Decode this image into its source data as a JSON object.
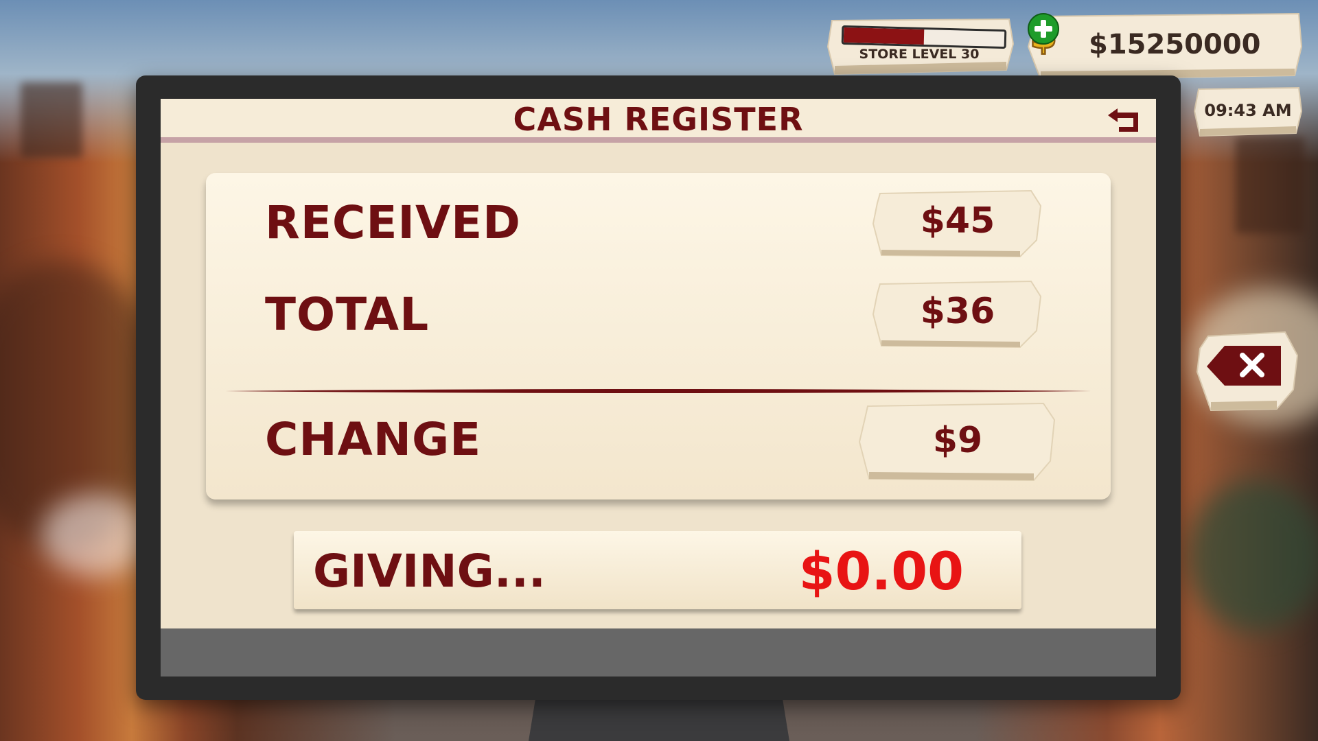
{
  "hud": {
    "store_level_label": "STORE LEVEL  30",
    "store_level_progress": 0.5,
    "money": "$15250000",
    "time": "09:43 AM"
  },
  "register": {
    "title": "CASH REGISTER",
    "rows": {
      "received": {
        "label": "RECEIVED",
        "value": "$45"
      },
      "total": {
        "label": "TOTAL",
        "value": "$36"
      },
      "change": {
        "label": "CHANGE",
        "value": "$9"
      }
    },
    "giving": {
      "label": "GIVING...",
      "amount": "$0.00"
    }
  },
  "icons": {
    "back": "back-arrow-icon",
    "coin": "dollar-coin-icon",
    "add": "plus-icon",
    "clear": "backspace-icon"
  },
  "colors": {
    "title_text": "#6e0f12",
    "giving_amount": "#e81414",
    "screen_bg": "#efe3cc",
    "add_button": "#1e9c2a"
  }
}
